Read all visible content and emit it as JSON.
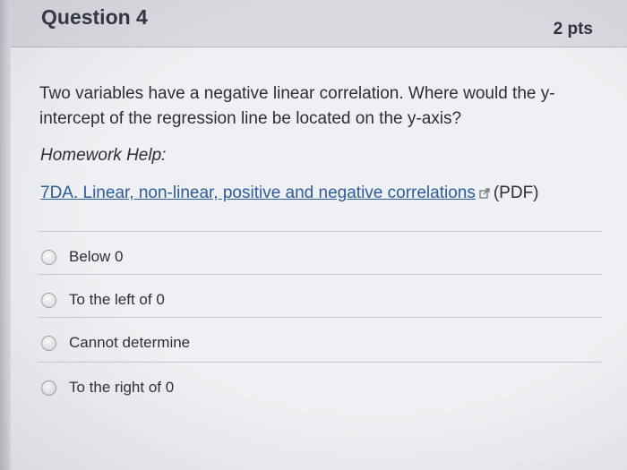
{
  "question": {
    "title": "Question 4",
    "points": "2 pts",
    "text": "Two variables have a negative linear correlation. Where would the y-intercept of the regression line be located on the y-axis?"
  },
  "homework_help": {
    "label": "Homework Help:",
    "link_text": "7DA. Linear, non-linear, positive and negative correlations",
    "link_suffix": "(PDF)",
    "link_icon": "external-link-icon"
  },
  "answers": [
    {
      "label": "Below 0",
      "selected": false
    },
    {
      "label": "To the left of 0",
      "selected": false
    },
    {
      "label": "Cannot determine",
      "selected": false
    },
    {
      "label": "To the right of 0",
      "selected": false
    }
  ]
}
